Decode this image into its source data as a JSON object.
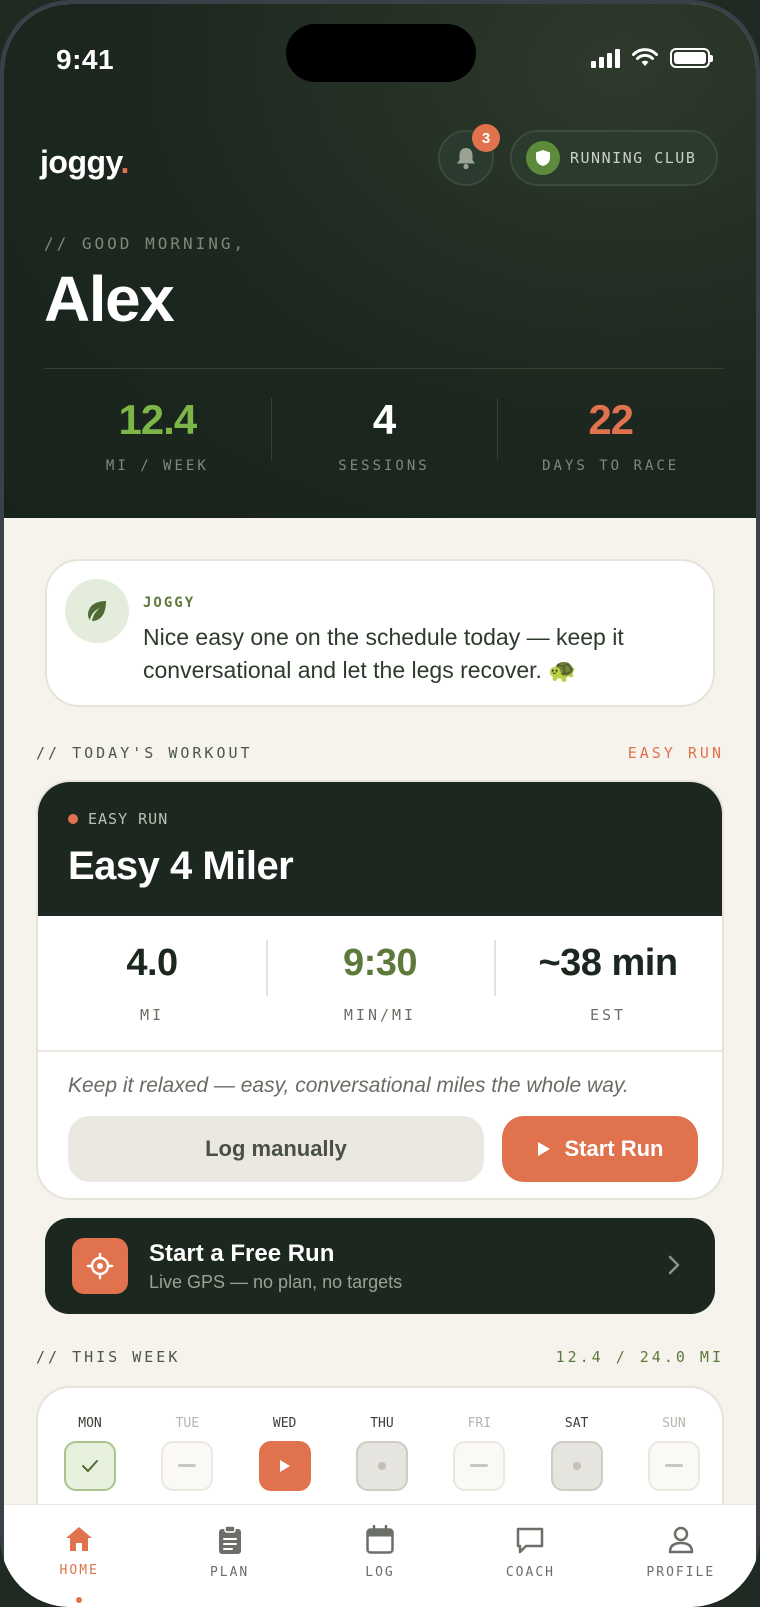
{
  "status_bar": {
    "time": "9:41"
  },
  "header": {
    "logo_text": "joggy",
    "logo_dot": ".",
    "notification_count": "3",
    "club_label": "RUNNING CLUB",
    "greeting": "// GOOD MORNING,",
    "user_name": "Alex"
  },
  "hero_stats": [
    {
      "value": "12.4",
      "label": "MI / WEEK",
      "color": "#7cb548"
    },
    {
      "value": "4",
      "label": "SESSIONS",
      "color": "#ffffff"
    },
    {
      "value": "22",
      "label": "DAYS TO RACE",
      "color": "#e0724e"
    }
  ],
  "coach": {
    "name": "JOGGY",
    "message": "Nice easy one on the schedule today — keep it conversational and let the legs recover. 🐢"
  },
  "todays_workout": {
    "section_label": "// TODAY'S WORKOUT",
    "section_tag": "EASY RUN",
    "tag": "EASY RUN",
    "title": "Easy 4 Miler",
    "stats": [
      {
        "value": "4.0",
        "label": "MI",
        "color": "#1c271f"
      },
      {
        "value": "9:30",
        "label": "MIN/MI",
        "color": "#5e7a3a"
      },
      {
        "value": "~38 min",
        "label": "EST",
        "color": "#1c271f"
      }
    ],
    "note": "Keep it relaxed — easy, conversational miles the whole way.",
    "log_button": "Log manually",
    "start_button": "Start Run"
  },
  "free_run": {
    "title": "Start a Free Run",
    "subtitle": "Live GPS — no plan, no targets"
  },
  "this_week": {
    "section_label": "// THIS WEEK",
    "progress": "12.4 / 24.0 MI",
    "days": [
      {
        "label": "MON",
        "state": "done"
      },
      {
        "label": "TUE",
        "state": "rest"
      },
      {
        "label": "WED",
        "state": "today"
      },
      {
        "label": "THU",
        "state": "planned"
      },
      {
        "label": "FRI",
        "state": "rest"
      },
      {
        "label": "SAT",
        "state": "planned"
      },
      {
        "label": "SUN",
        "state": "rest"
      }
    ]
  },
  "tabbar": [
    {
      "label": "HOME",
      "icon": "home-icon",
      "active": true
    },
    {
      "label": "PLAN",
      "icon": "clipboard-icon",
      "active": false
    },
    {
      "label": "LOG",
      "icon": "calendar-icon",
      "active": false
    },
    {
      "label": "COACH",
      "icon": "chat-icon",
      "active": false
    },
    {
      "label": "PROFILE",
      "icon": "person-icon",
      "active": false
    }
  ],
  "colors": {
    "accent": "#e0724e",
    "green": "#5e7a3a",
    "dark": "#1c271f",
    "background": "#f6f3ed"
  }
}
